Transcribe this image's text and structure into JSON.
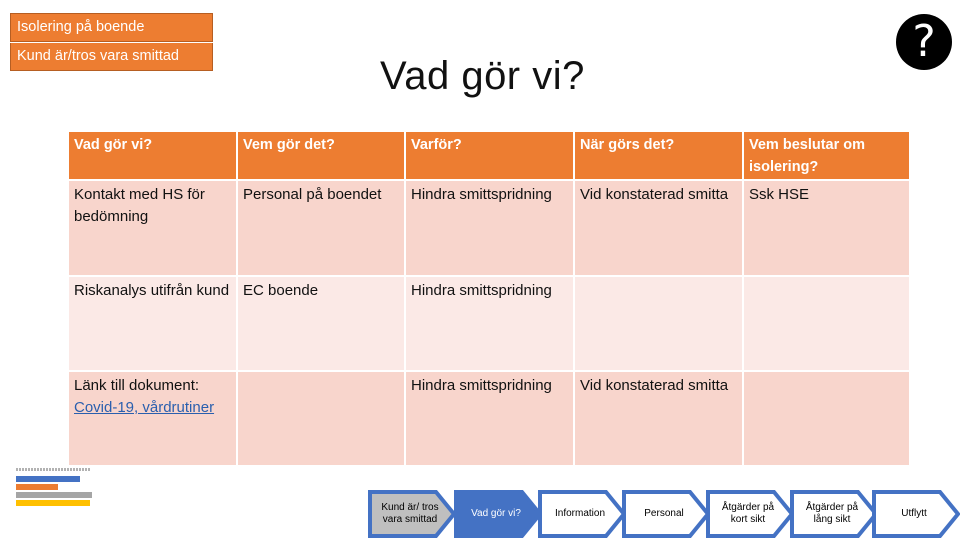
{
  "breadcrumbs": [
    "Isolering på boende",
    "Kund är/tros vara smittad"
  ],
  "help_icon": "question-circle-icon",
  "page_title": "Vad gör vi?",
  "table": {
    "headers": [
      "Vad gör vi?",
      "Vem gör det?",
      "Varför?",
      "När görs det?",
      "Vem beslutar om isolering?"
    ],
    "rows": [
      [
        "Kontakt med HS för bedömning",
        "Personal på boendet",
        "Hindra smittspridning",
        "Vid konstaterad smitta",
        "Ssk HSE"
      ],
      [
        "Riskanalys utifrån kund",
        "EC boende",
        "Hindra smittspridning",
        "",
        ""
      ],
      [
        "Länk till dokument:",
        "",
        "Hindra smittspridning",
        "Vid konstaterad smitta",
        ""
      ]
    ],
    "link_text": "Covid-19, vårdrutiner"
  },
  "legend": {
    "swatches": [
      {
        "color": "#4472c4"
      },
      {
        "color": "#ed7d31"
      },
      {
        "color": "#a5a5a5"
      },
      {
        "color": "#ffc000"
      }
    ]
  },
  "flow": {
    "steps": [
      {
        "label": "Kund är/ tros vara smittad",
        "state": "done"
      },
      {
        "label": "Vad gör vi?",
        "state": "current"
      },
      {
        "label": "Information",
        "state": "todo"
      },
      {
        "label": "Personal",
        "state": "todo"
      },
      {
        "label": "Åtgärder på kort sikt",
        "state": "todo"
      },
      {
        "label": "Åtgärder på lång sikt",
        "state": "todo"
      },
      {
        "label": "Utflytt",
        "state": "todo"
      }
    ]
  },
  "colors": {
    "accent": "#ed7d31",
    "flow_blue": "#4472c4",
    "done_fill": "#bfbfbf",
    "row_dark": "#f8d5cc",
    "row_light": "#fbe9e6",
    "link": "#2a5fae"
  }
}
